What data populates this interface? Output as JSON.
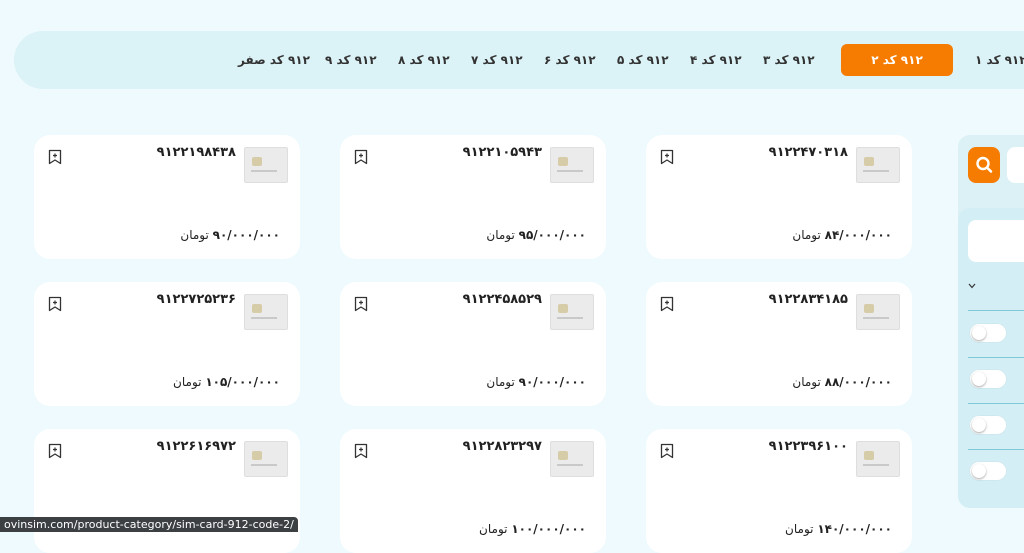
{
  "tabs": [
    {
      "label": "۹۱۲ کد ۱",
      "active": false
    },
    {
      "label": "۹۱۲ کد ۲",
      "active": true
    },
    {
      "label": "۹۱۲ کد ۳",
      "active": false
    },
    {
      "label": "۹۱۲ کد ۴",
      "active": false
    },
    {
      "label": "۹۱۲ کد ۵",
      "active": false
    },
    {
      "label": "۹۱۲ کد ۶",
      "active": false
    },
    {
      "label": "۹۱۲ کد ۷",
      "active": false
    },
    {
      "label": "۹۱۲ کد ۸",
      "active": false
    },
    {
      "label": "۹۱۲ کد ۹",
      "active": false
    },
    {
      "label": "۹۱۲ کد صفر",
      "active": false
    }
  ],
  "currency": "تومان",
  "cards": [
    {
      "number": "۹۱۲۲۴۷۰۳۱۸",
      "price": "۸۴/۰۰۰/۰۰۰"
    },
    {
      "number": "۹۱۲۲۱۰۵۹۴۳",
      "price": "۹۵/۰۰۰/۰۰۰"
    },
    {
      "number": "۹۱۲۲۱۹۸۴۳۸",
      "price": "۹۰/۰۰۰/۰۰۰"
    },
    {
      "number": "۹۱۲۲۸۳۴۱۸۵",
      "price": "۸۸/۰۰۰/۰۰۰"
    },
    {
      "number": "۹۱۲۲۴۵۸۵۲۹",
      "price": "۹۰/۰۰۰/۰۰۰"
    },
    {
      "number": "۹۱۲۲۷۲۵۲۳۶",
      "price": "۱۰۵/۰۰۰/۰۰۰"
    },
    {
      "number": "۹۱۲۲۳۹۶۱۰۰",
      "price": "۱۴۰/۰۰۰/۰۰۰"
    },
    {
      "number": "۹۱۲۲۸۲۳۲۹۷",
      "price": "۱۰۰/۰۰۰/۰۰۰"
    },
    {
      "number": "۹۱۲۲۶۱۶۹۷۲",
      "price": ""
    }
  ],
  "colors": {
    "accent": "#f57c00",
    "background": "#eefafd",
    "bar": "#dbf2f7"
  },
  "icons": {
    "search": "search-icon",
    "bookmark": "bookmark-add-icon",
    "chevron": "chevron-down-icon"
  },
  "status_url": "ovinsim.com/product-category/sim-card-912-code-2/"
}
